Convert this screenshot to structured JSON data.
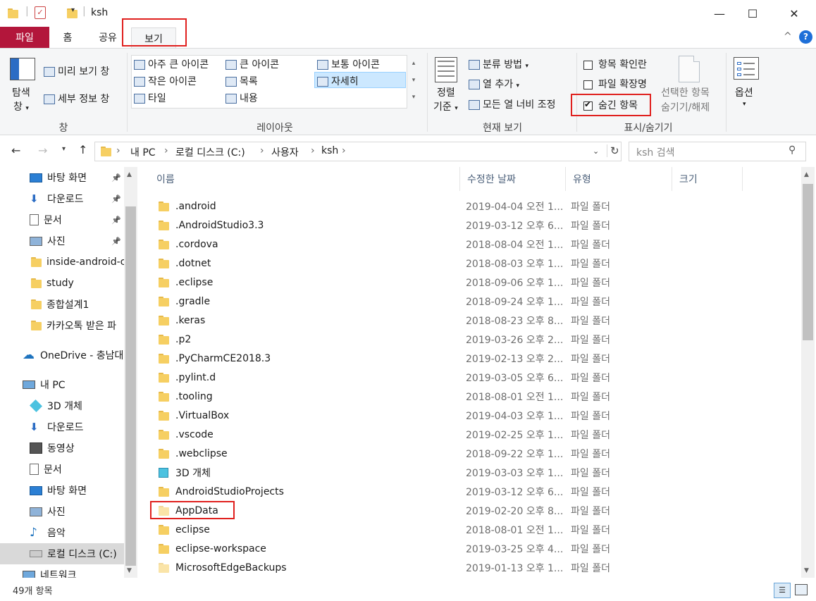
{
  "window": {
    "title": "ksh"
  },
  "window_controls": {
    "minimize": "—",
    "maximize": "☐",
    "close": "✕"
  },
  "tabs": [
    {
      "label": "파일"
    },
    {
      "label": "홈"
    },
    {
      "label": "공유"
    },
    {
      "label": "보기"
    }
  ],
  "ribbon": {
    "pane": {
      "nav_pane_line1": "탐색",
      "nav_pane_line2": "창",
      "preview_pane": "미리 보기 창",
      "details_pane": "세부 정보 창",
      "group_label": "창"
    },
    "layout": {
      "items": [
        "아주 큰 아이콘",
        "큰 아이콘",
        "보통 아이콘",
        "작은 아이콘",
        "목록",
        "자세히",
        "타일",
        "내용"
      ],
      "selected": "자세히",
      "group_label": "레이아웃"
    },
    "current_view": {
      "sort_line1": "정렬",
      "sort_line2": "기준",
      "group_by": "분류 방법",
      "add_columns": "열 추가",
      "size_all_columns": "모든 열 너비 조정",
      "group_label": "현재 보기"
    },
    "show_hide": {
      "item_check_boxes": "항목 확인란",
      "file_name_extensions": "파일 확장명",
      "hidden_items": "숨긴 항목",
      "item_check_boxes_checked": false,
      "file_name_extensions_checked": false,
      "hidden_items_checked": true,
      "hide_selected_line1": "선택한 항목",
      "hide_selected_line2": "숨기기/해제",
      "group_label": "표시/숨기기"
    },
    "options": {
      "label": "옵션"
    },
    "help": "?",
    "collapse": "^"
  },
  "address": {
    "breadcrumbs": [
      "내 PC",
      "로컬 디스크 (C:)",
      "사용자",
      "ksh"
    ],
    "search_placeholder": "ksh 검색"
  },
  "sidebar": {
    "quick_access": [
      {
        "label": "바탕 화면",
        "icon": "desktop-icon",
        "pinned": true
      },
      {
        "label": "다운로드",
        "icon": "download-icon",
        "pinned": true
      },
      {
        "label": "문서",
        "icon": "document-icon",
        "pinned": true
      },
      {
        "label": "사진",
        "icon": "pictures-icon",
        "pinned": true
      },
      {
        "label": "inside-android-c",
        "icon": "folder-icon",
        "pinned": false
      },
      {
        "label": "study",
        "icon": "folder-icon",
        "pinned": false
      },
      {
        "label": "종합설계1",
        "icon": "folder-icon",
        "pinned": false
      },
      {
        "label": "카카오톡 받은 파",
        "icon": "folder-icon",
        "pinned": false
      }
    ],
    "onedrive": {
      "label": "OneDrive - 충남대",
      "icon": "cloud-icon"
    },
    "this_pc": {
      "label": "내 PC",
      "icon": "computer-icon"
    },
    "pc_items": [
      {
        "label": "3D 개체",
        "icon": "3d-objects-icon"
      },
      {
        "label": "다운로드",
        "icon": "download-icon"
      },
      {
        "label": "동영상",
        "icon": "video-icon"
      },
      {
        "label": "문서",
        "icon": "document-icon"
      },
      {
        "label": "바탕 화면",
        "icon": "desktop-icon"
      },
      {
        "label": "사진",
        "icon": "pictures-icon"
      },
      {
        "label": "음악",
        "icon": "music-icon"
      },
      {
        "label": "로컬 디스크 (C:)",
        "icon": "drive-icon"
      }
    ],
    "network": {
      "label": "네트워크",
      "icon": "network-icon"
    }
  },
  "columns": {
    "name": "이름",
    "date": "수정한 날짜",
    "type": "유형",
    "size": "크기"
  },
  "files": [
    {
      "name": ".android",
      "date": "2019-04-04 오전 1...",
      "type": "파일 폴더"
    },
    {
      "name": ".AndroidStudio3.3",
      "date": "2019-03-12 오후 6...",
      "type": "파일 폴더"
    },
    {
      "name": ".cordova",
      "date": "2018-08-04 오전 1...",
      "type": "파일 폴더"
    },
    {
      "name": ".dotnet",
      "date": "2018-08-03 오후 1...",
      "type": "파일 폴더"
    },
    {
      "name": ".eclipse",
      "date": "2018-09-06 오후 1...",
      "type": "파일 폴더"
    },
    {
      "name": ".gradle",
      "date": "2018-09-24 오후 1...",
      "type": "파일 폴더"
    },
    {
      "name": ".keras",
      "date": "2018-08-23 오후 8...",
      "type": "파일 폴더"
    },
    {
      "name": ".p2",
      "date": "2019-03-26 오후 2...",
      "type": "파일 폴더"
    },
    {
      "name": ".PyCharmCE2018.3",
      "date": "2019-02-13 오후 2...",
      "type": "파일 폴더"
    },
    {
      "name": ".pylint.d",
      "date": "2019-03-05 오후 6...",
      "type": "파일 폴더"
    },
    {
      "name": ".tooling",
      "date": "2018-08-01 오전 1...",
      "type": "파일 폴더"
    },
    {
      "name": ".VirtualBox",
      "date": "2019-04-03 오후 1...",
      "type": "파일 폴더"
    },
    {
      "name": ".vscode",
      "date": "2019-02-25 오후 1...",
      "type": "파일 폴더"
    },
    {
      "name": ".webclipse",
      "date": "2018-09-22 오후 1...",
      "type": "파일 폴더"
    },
    {
      "name": "3D 개체",
      "date": "2019-03-03 오후 1...",
      "type": "파일 폴더"
    },
    {
      "name": "AndroidStudioProjects",
      "date": "2019-03-12 오후 6...",
      "type": "파일 폴더"
    },
    {
      "name": "AppData",
      "date": "2019-02-20 오후 8...",
      "type": "파일 폴더"
    },
    {
      "name": "eclipse",
      "date": "2018-08-01 오전 1...",
      "type": "파일 폴더"
    },
    {
      "name": "eclipse-workspace",
      "date": "2019-03-25 오후 4...",
      "type": "파일 폴더"
    },
    {
      "name": "MicrosoftEdgeBackups",
      "date": "2019-01-13 오후 1...",
      "type": "파일 폴더"
    }
  ],
  "status": {
    "item_count": "49개 항목"
  }
}
